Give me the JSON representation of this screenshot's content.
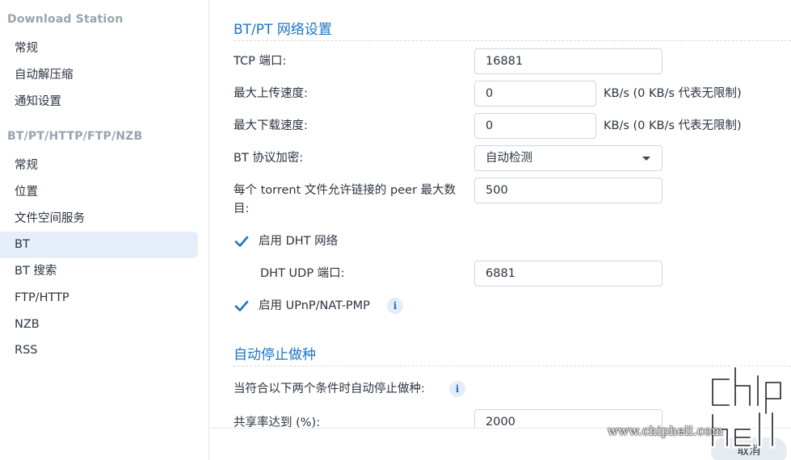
{
  "sidebar": {
    "section1": "Download Station",
    "items1": [
      "常规",
      "自动解压缩",
      "通知设置"
    ],
    "section2": "BT/PT/HTTP/FTP/NZB",
    "items2": [
      "常规",
      "位置",
      "文件空间服务",
      "BT",
      "BT 搜索",
      "FTP/HTTP",
      "NZB",
      "RSS"
    ],
    "active": "BT"
  },
  "network": {
    "title": "BT/PT 网络设置",
    "tcp_label": "TCP 端口:",
    "tcp_value": "16881",
    "upload_label": "最大上传速度:",
    "upload_value": "0",
    "upload_suffix": "KB/s (0 KB/s 代表无限制)",
    "download_label": "最大下载速度:",
    "download_value": "0",
    "download_suffix": "KB/s (0 KB/s 代表无限制)",
    "encrypt_label": "BT 协议加密:",
    "encrypt_value": "自动检测",
    "peer_label_line1": "每个 torrent 文件允许链接的 peer 最大数",
    "peer_label_line2": "目:",
    "peer_value": "500",
    "dht_label": "启用 DHT 网络",
    "dht_checked": true,
    "dht_udp_label": "DHT UDP 端口:",
    "dht_udp_value": "6881",
    "upnp_label": "启用 UPnP/NAT-PMP",
    "upnp_checked": true
  },
  "autostop": {
    "title": "自动停止做种",
    "condition_label": "当符合以下两个条件时自动停止做种:",
    "ratio_label": "共享率达到 (%):",
    "ratio_value": "2000"
  },
  "footer": {
    "cancel_label": "取消"
  },
  "watermark": {
    "text": "www.chiphell.com"
  },
  "colors": {
    "accent": "#1b74c5",
    "active_bg": "#e6eef9"
  }
}
